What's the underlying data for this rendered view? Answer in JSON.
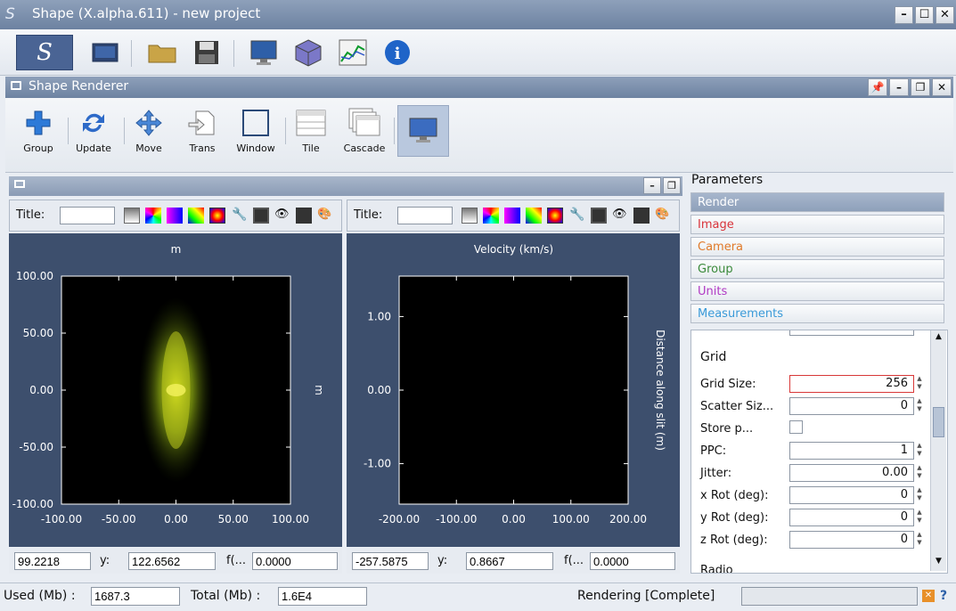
{
  "window": {
    "logo": "S",
    "title": "Shape (X.alpha.611) - new project",
    "min": "–",
    "max": "☐",
    "close": "✕"
  },
  "renderer": {
    "title": "Shape Renderer",
    "tools": [
      {
        "label": "Group",
        "icon": "plus-icon"
      },
      {
        "label": "Update",
        "icon": "refresh-icon"
      },
      {
        "label": "Move",
        "icon": "move-icon"
      },
      {
        "label": "Trans",
        "icon": "transform-icon"
      },
      {
        "label": "Window",
        "icon": "window-icon"
      },
      {
        "label": "Tile",
        "icon": "tile-icon"
      },
      {
        "label": "Cascade",
        "icon": "cascade-icon"
      }
    ]
  },
  "left_panel": {
    "title_label": "Title:",
    "readouts": {
      "x": "99.2218",
      "y_label": "y:",
      "y": "122.6562",
      "f_label": "f(...",
      "f": "0.0000"
    }
  },
  "right_panel": {
    "title_label": "Title:",
    "readouts": {
      "x": "-257.5875",
      "y_label": "y:",
      "y": "0.8667",
      "f_label": "f(...",
      "f": "0.0000"
    }
  },
  "chart_data": [
    {
      "type": "heatmap",
      "title": "m",
      "ylabel": "m",
      "xlim": [
        -100,
        100
      ],
      "ylim": [
        -100,
        100
      ],
      "xticks": [
        "-100.00",
        "-50.00",
        "0.00",
        "50.00",
        "100.00"
      ],
      "yticks": [
        "100.00",
        "50.00",
        "0.00",
        "-50.00",
        "-100.00"
      ]
    },
    {
      "type": "heatmap",
      "title": "Velocity (km/s)",
      "ylabel": "Distance along slit (m)",
      "xlim": [
        -200,
        200
      ],
      "xticks": [
        "-200.00",
        "-100.00",
        "0.00",
        "100.00",
        "200.00"
      ],
      "yticks": [
        "1.00",
        "0.00",
        "-1.00"
      ]
    }
  ],
  "parameters": {
    "title": "Parameters",
    "tabs": [
      "Render",
      "Image",
      "Camera",
      "Group",
      "Units",
      "Measurements"
    ],
    "tab_colors": [
      "#ffffff",
      "#d8333a",
      "#e07a2a",
      "#3a8a3a",
      "#b03ac4",
      "#3a9ad8"
    ],
    "section": "Grid",
    "rows": [
      {
        "label": "Grid Size:",
        "value": "256"
      },
      {
        "label": "Scatter Siz...",
        "value": "0"
      },
      {
        "label": "Store p...",
        "value": ""
      },
      {
        "label": "PPC:",
        "value": "1"
      },
      {
        "label": "Jitter:",
        "value": "0.00"
      },
      {
        "label": "x Rot (deg):",
        "value": "0"
      },
      {
        "label": "y Rot (deg):",
        "value": "0"
      },
      {
        "label": "z Rot (deg):",
        "value": "0"
      }
    ],
    "cut_bottom": "Radio"
  },
  "status": {
    "used_label": "Used (Mb) :",
    "used": "1687.3",
    "total_label": "Total (Mb) :",
    "total": "1.6E4",
    "state": "Rendering [Complete]",
    "help": "?"
  }
}
